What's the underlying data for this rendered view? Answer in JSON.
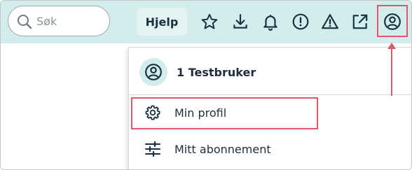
{
  "header": {
    "search_placeholder": "Søk",
    "help_label": "Hjelp",
    "icons": [
      "star-icon",
      "download-icon",
      "bell-icon",
      "alert-circle-icon",
      "warning-icon",
      "external-link-icon",
      "user-circle-icon"
    ]
  },
  "user_menu": {
    "user_name": "1 Testbruker",
    "items": [
      {
        "label": "Min profil",
        "icon": "gear-icon"
      },
      {
        "label": "Mitt abonnement",
        "icon": "sliders-icon"
      }
    ]
  },
  "colors": {
    "topbar": "#d3ecec",
    "highlight": "#e0566c",
    "text": "#1f2d3d"
  }
}
